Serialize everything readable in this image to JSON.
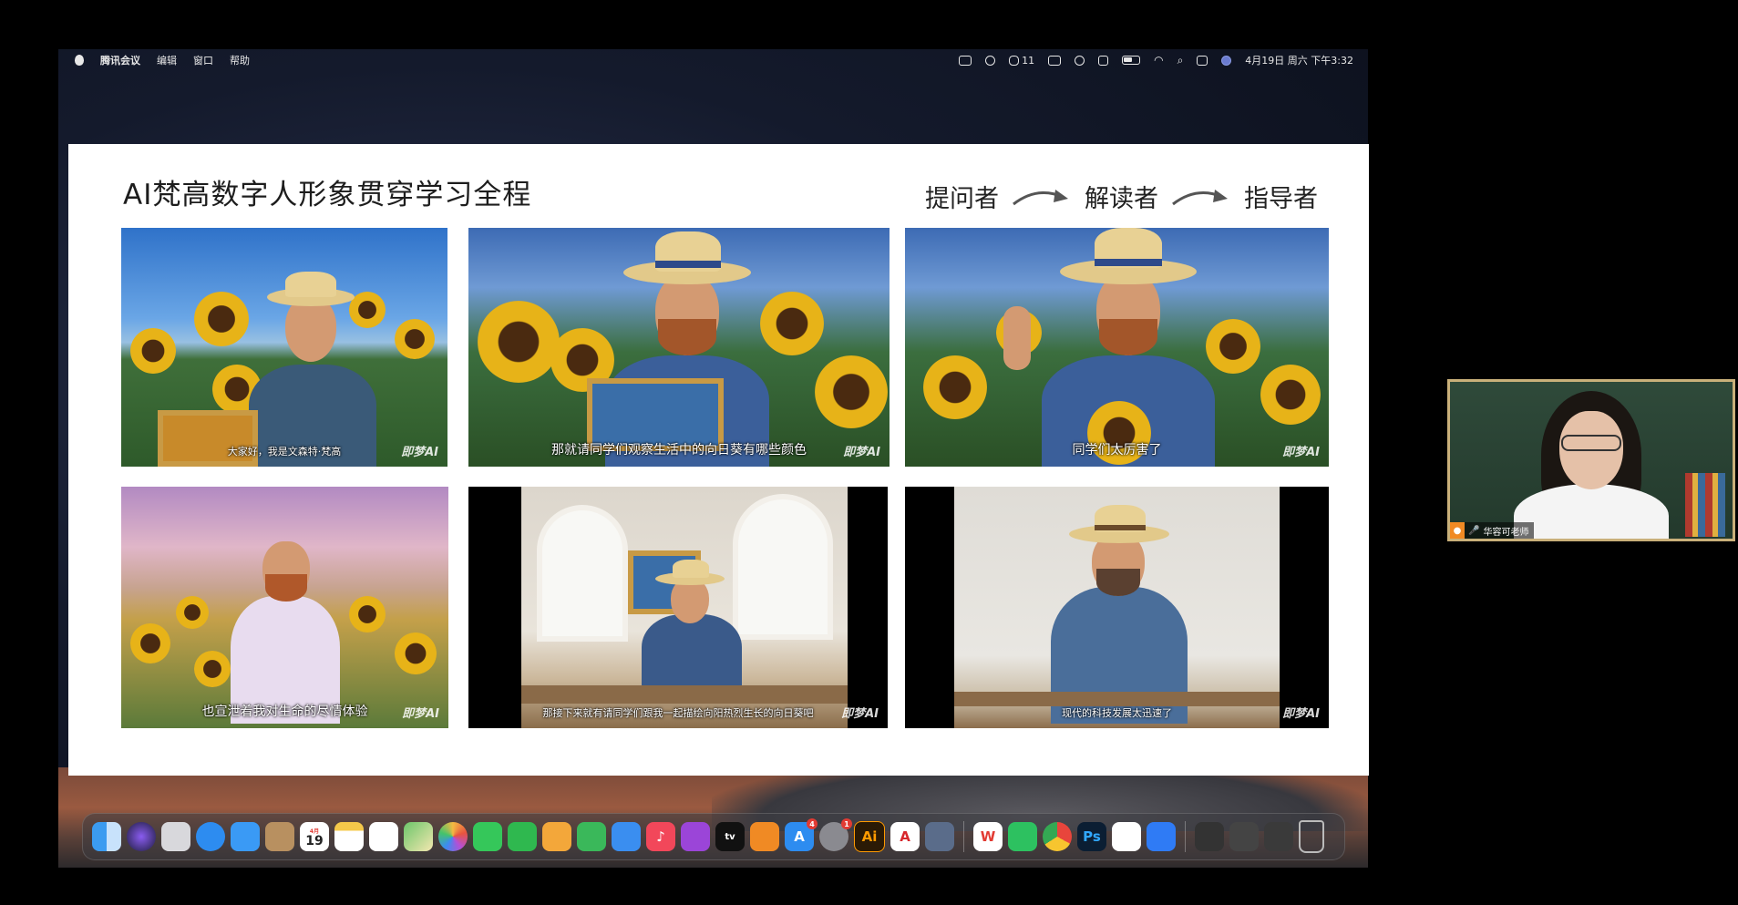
{
  "menubar": {
    "app_name": "腾讯会议",
    "menus": [
      "编辑",
      "窗口",
      "帮助"
    ],
    "status_icons": [
      "wps-icon",
      "finder-link-icon",
      "wechat-icon",
      "screen-mirror-icon",
      "eye-icon",
      "calculator-icon",
      "battery-icon",
      "wifi-icon",
      "search-icon",
      "control-center-icon",
      "siri-icon"
    ],
    "wechat_count": "11",
    "datetime": "4月19日 周六 下午3:32"
  },
  "slide": {
    "title": "AI梵高数字人形象贯穿学习全程",
    "roles": [
      "提问者",
      "解读者",
      "指导者"
    ],
    "panels": [
      {
        "caption": "大家好，我是文森特·梵高"
      },
      {
        "caption": "那就请同学们观察生活中的向日葵有哪些颜色"
      },
      {
        "caption": "同学们太厉害了"
      },
      {
        "caption": "也宣泄着我对生命的尽情体验"
      },
      {
        "caption": "那接下来就有请同学们跟我一起描绘向阳热烈生长的向日葵吧"
      },
      {
        "caption": "现代的科技发展太迅速了"
      }
    ],
    "watermark": "即梦AI"
  },
  "webcam": {
    "name": "华容可老师"
  },
  "dock": {
    "calendar_month": "4月",
    "calendar_day": "19",
    "mail_badge": "4",
    "settings_badge": "1",
    "items": [
      "finder-icon",
      "siri-icon",
      "launchpad-icon",
      "safari-icon",
      "mail-icon",
      "contacts-icon",
      "calendar-icon",
      "notes-icon",
      "reminders-icon",
      "maps-icon",
      "photos-icon",
      "messages-icon",
      "facetime-icon",
      "pages-icon",
      "numbers-icon",
      "keynote-icon",
      "music-icon",
      "podcasts-icon",
      "tv-icon",
      "books-icon",
      "appstore-icon",
      "settings-icon",
      "illustrator-icon",
      "acrobat-icon",
      "app-icon",
      "wps-icon",
      "wechat-icon",
      "chrome-icon",
      "photoshop-icon",
      "baidu-netdisk-icon",
      "tencent-meeting-icon",
      "window-icon",
      "window-icon",
      "window-icon",
      "trash-icon"
    ]
  }
}
